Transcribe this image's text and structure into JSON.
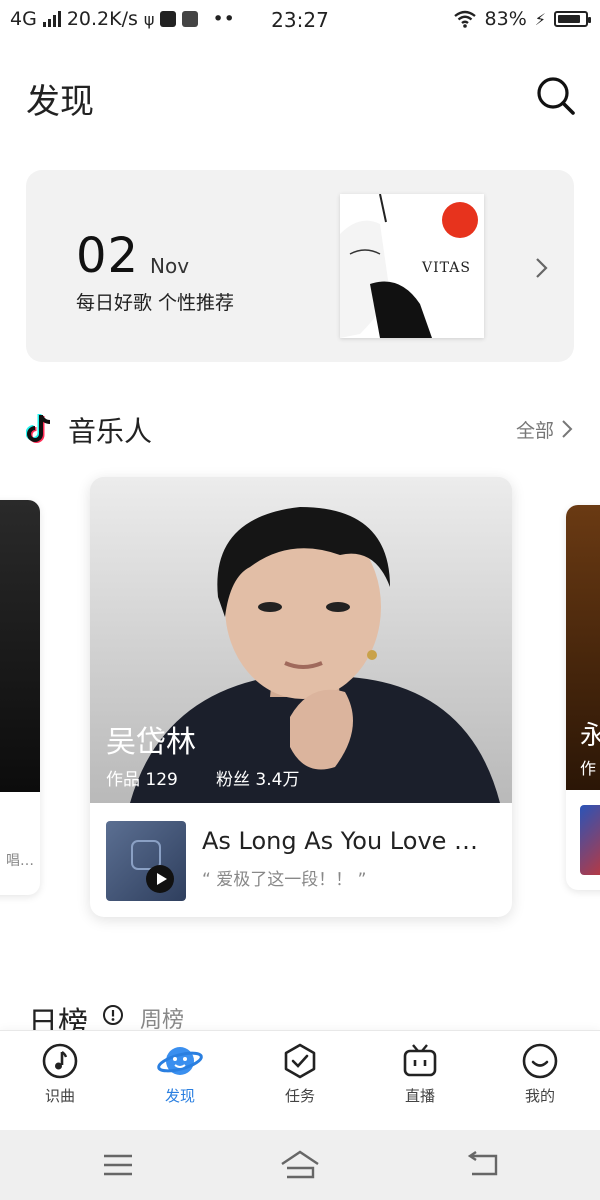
{
  "status_bar": {
    "network": "4G",
    "speed": "20.2K/s",
    "time": "23:27",
    "battery_percent": "83%",
    "battery_level": 0.83
  },
  "header": {
    "title": "发现",
    "search_icon": "search-icon"
  },
  "daily": {
    "day": "02",
    "month": "Nov",
    "subtitle": "每日好歌 个性推荐",
    "album_text": "VITAS"
  },
  "musicians": {
    "title": "音乐人",
    "more": "全部",
    "main": {
      "name": "吴岱林",
      "works": "作品 129",
      "fans": "粉丝 3.4万",
      "song_title": "As Long As You Love M…",
      "song_quote": "“ 爱极了这一段！！ ”"
    },
    "left_peek_text": "唱…",
    "right_peek": {
      "name": "永",
      "sub": "作"
    }
  },
  "rank": {
    "title": "日榜",
    "tab": "周榜"
  },
  "bottom_nav": {
    "items": [
      {
        "label": "识曲",
        "icon": "music-note-icon"
      },
      {
        "label": "发现",
        "icon": "planet-icon",
        "active": true
      },
      {
        "label": "任务",
        "icon": "shield-check-icon"
      },
      {
        "label": "直播",
        "icon": "tv-icon"
      },
      {
        "label": "我的",
        "icon": "smile-icon"
      }
    ]
  },
  "colors": {
    "accent": "#2a7fe0",
    "card_bg": "#f2f2f2",
    "album_badge": "#e7331d"
  }
}
